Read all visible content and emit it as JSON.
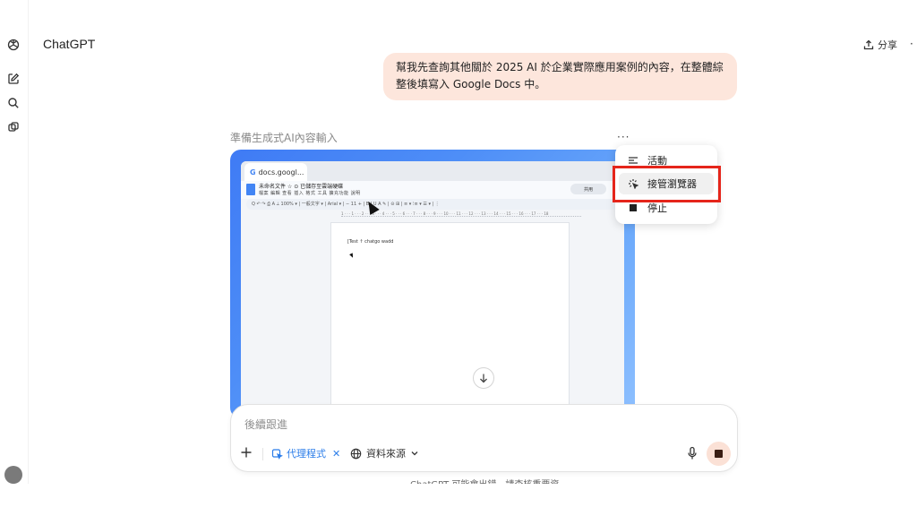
{
  "app": {
    "title": "ChatGPT"
  },
  "header": {
    "share_label": "分享",
    "more_label": "·"
  },
  "sidebar": {
    "icons": [
      "openai-logo-icon",
      "new-chat-icon",
      "search-icon",
      "library-icon"
    ]
  },
  "conversation": {
    "user_message": "幫我先查詢其他關於 2025 AI 於企業實際應用案例的內容，在整體綜整後填寫入 Google Docs 中。",
    "agent_status": "準備生成式AI內容輸入",
    "more_label": "···"
  },
  "browser": {
    "tab_label": "docs.googl...",
    "doc_title": "未命名文件  ☆  ⊙ 已儲存至雲端硬碟",
    "doc_menu": "檔案  編輯  查看  插入  格式  工具  擴充功能  說明",
    "share_label": "共用",
    "toolbar": "Q  ↶  ↷  ⎙  A  ⟂  100% ▾ | 一般文字 ▾ | Arial ▾ | − 11 + | B  I  U  A  ✎ | ⊝  ⊞ | ≡ ▾  ⁝≡ ▾  ☰ ▾ | ⋮",
    "ruler": "1 · · · 1 · · · 2 · · · 3 · · · 4 · · · 5 · · · 6 · · · 7 · · · 8 · · · 9 · · · 10 · · · 11 · · · 12 · · · 13 · · · 14 · · · 15 · · · 16 · · · 17 · · · 18",
    "page_text": "[Test ↑ chatgo wadd"
  },
  "menu": {
    "items": [
      {
        "icon": "activity-icon",
        "label": "活動"
      },
      {
        "icon": "takeover-icon",
        "label": "接管瀏覽器"
      },
      {
        "icon": "stop-square-icon",
        "label": "停止"
      }
    ]
  },
  "composer": {
    "placeholder": "後續跟進",
    "agent_chip": "代理程式",
    "sources_label": "資料來源"
  },
  "footer": {
    "disclaimer": "ChatGPT 可能會出錯，請查核重要資訊。"
  },
  "colors": {
    "bubble": "#fde6dc",
    "accent_blue": "#2b7de9",
    "highlight_red": "#e5251b",
    "stop_button": "#fbe1d6"
  }
}
